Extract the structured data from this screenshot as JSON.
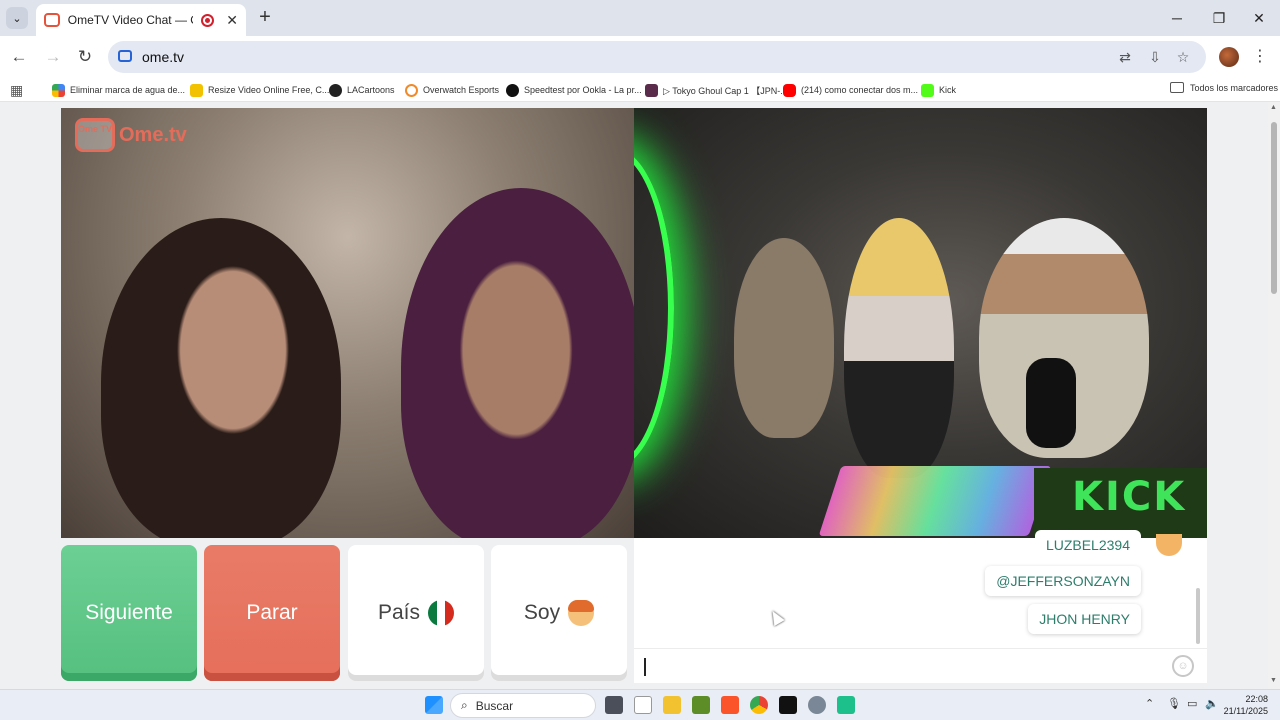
{
  "browser": {
    "tab_title": "OmeTV Video Chat — Omegle Rand",
    "url": "ome.tv",
    "bookmarks": [
      {
        "label": "Eliminar marca de agua de...",
        "icon": "bookmark-icon-google"
      },
      {
        "label": "Resize Video Online Free, C...",
        "icon": "bookmark-icon-resize"
      },
      {
        "label": "LACartoons",
        "icon": "bookmark-icon-lacartoons"
      },
      {
        "label": "Overwatch Esports",
        "icon": "bookmark-icon-overwatch"
      },
      {
        "label": "Speedtest por Ookla - La pr...",
        "icon": "bookmark-icon-speedtest"
      },
      {
        "label": "▷ Tokyo Ghoul Cap 1 【JPN-...",
        "icon": "bookmark-icon-tokyo"
      },
      {
        "label": "(214) como conectar dos m...",
        "icon": "bookmark-icon-youtube"
      },
      {
        "label": "Kick",
        "icon": "bookmark-icon-kick"
      }
    ],
    "all_bookmarks": "Todos los marcadores"
  },
  "app": {
    "logo_tv": "Ome TV",
    "logo_text": "Ome.tv",
    "buttons": {
      "next": "Siguiente",
      "stop": "Parar",
      "country": "País",
      "gender": "Soy"
    },
    "kick_mat": "KICK"
  },
  "chat": {
    "messages": [
      "LUZBEL2394",
      "@JEFFERSONZAYN",
      "JHON HENRY"
    ],
    "input_value": ""
  },
  "taskbar": {
    "search_placeholder": "Buscar",
    "time": "22:08",
    "date": "21/11/2025"
  },
  "colors": {
    "next": "#5ec586",
    "stop": "#e8735f",
    "accent_chat": "#2e7d6b",
    "brand": "#e46c5a"
  }
}
